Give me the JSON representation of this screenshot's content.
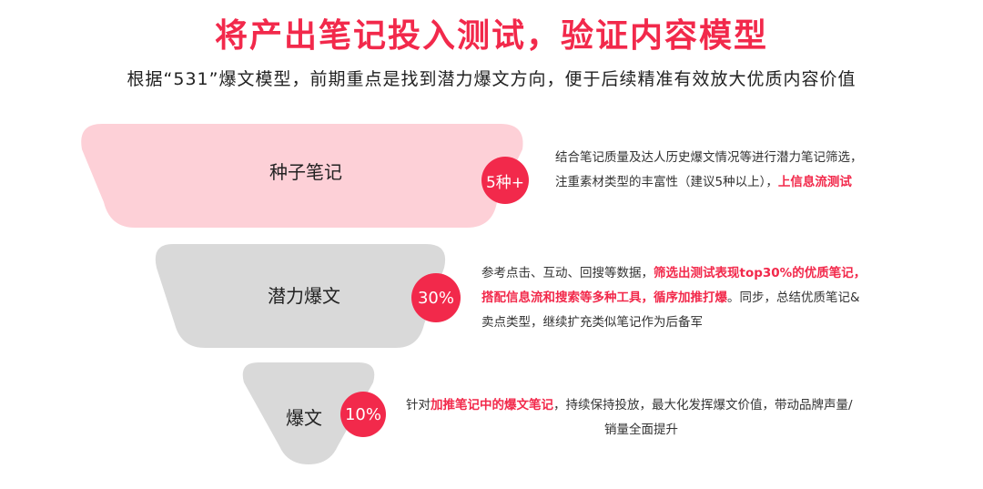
{
  "title": "将产出笔记投入测试，验证内容模型",
  "subtitle": "根据“531”爆文模型，前期重点是找到潜力爆文方向，便于后续精准有效放大优质内容价值",
  "colors": {
    "accent": "#f2294b",
    "stage1_fill": "#fdd0d7",
    "stage_gray": "#d9d9d9"
  },
  "stages": [
    {
      "label": "种子笔记",
      "badge": "5种+",
      "desc": {
        "l1": "结合笔记质量及达人历史爆文情况等进行潜力笔记筛选，",
        "l2a": "注重素材类型的丰富性（建议5种以上），",
        "l2b": "上信息流测试"
      }
    },
    {
      "label": "潜力爆文",
      "badge": "30%",
      "desc": {
        "l1a": "参考点击、互动、回搜等数据，",
        "l1b": "筛选出测试表现top30%的优质笔记，",
        "l2a": "搭配信息流和搜索等多种工具，循序加推打爆",
        "l2b": "。同步，总结优质笔记&",
        "l3": "卖点类型，继续扩充类似笔记作为后备军"
      }
    },
    {
      "label": "爆文",
      "badge": "10%",
      "desc": {
        "l1a": "针对",
        "l1b": "加推笔记中的爆文笔记",
        "l1c": "，持续保持投放，最大化发挥爆文价值，带动品牌声量/",
        "l2": "销量全面提升"
      }
    }
  ]
}
